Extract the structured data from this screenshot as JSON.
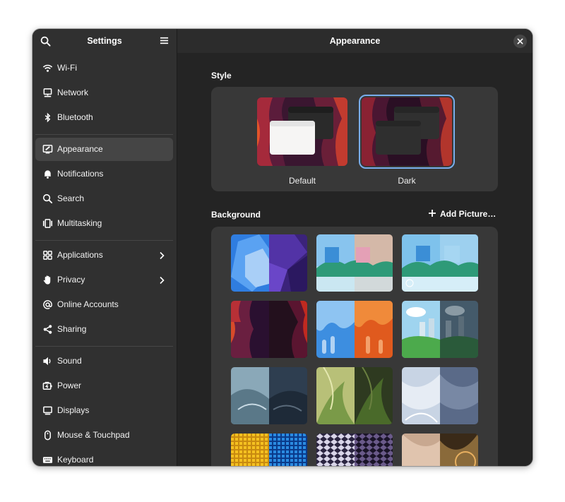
{
  "sidebar": {
    "title": "Settings",
    "items": [
      {
        "label": "Wi-Fi",
        "icon": "wifi-icon"
      },
      {
        "label": "Network",
        "icon": "network-icon"
      },
      {
        "label": "Bluetooth",
        "icon": "bluetooth-icon"
      },
      {
        "label": "Appearance",
        "icon": "appearance-icon",
        "active": true
      },
      {
        "label": "Notifications",
        "icon": "bell-icon"
      },
      {
        "label": "Search",
        "icon": "search-icon"
      },
      {
        "label": "Multitasking",
        "icon": "multitasking-icon"
      },
      {
        "label": "Applications",
        "icon": "apps-icon",
        "chevron": true
      },
      {
        "label": "Privacy",
        "icon": "hand-icon",
        "chevron": true
      },
      {
        "label": "Online Accounts",
        "icon": "at-icon"
      },
      {
        "label": "Sharing",
        "icon": "share-icon"
      },
      {
        "label": "Sound",
        "icon": "speaker-icon"
      },
      {
        "label": "Power",
        "icon": "power-icon"
      },
      {
        "label": "Displays",
        "icon": "display-icon"
      },
      {
        "label": "Mouse & Touchpad",
        "icon": "mouse-icon"
      },
      {
        "label": "Keyboard",
        "icon": "keyboard-icon"
      }
    ]
  },
  "main": {
    "title": "Appearance",
    "style_section": {
      "title": "Style",
      "options": [
        {
          "label": "Default",
          "selected": false
        },
        {
          "label": "Dark",
          "selected": true
        }
      ]
    },
    "background_section": {
      "title": "Background",
      "add_picture_label": "Add Picture…"
    }
  },
  "colors": {
    "accent": "#78aeed",
    "window_bg": "#242424",
    "sidebar_bg": "#303030",
    "card_bg": "#383838"
  }
}
